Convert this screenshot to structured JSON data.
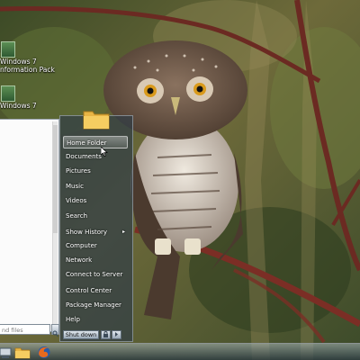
{
  "desktop": {
    "icons": [
      {
        "line1": "Windows 7",
        "line2": "nformation Pack"
      },
      {
        "line1": "Windows 7",
        "line2": ""
      }
    ]
  },
  "start_menu": {
    "items": [
      {
        "label": "Home Folder",
        "highlighted": true,
        "submenu": false
      },
      {
        "label": "Documents",
        "highlighted": false,
        "submenu": false
      },
      {
        "label": "Pictures",
        "highlighted": false,
        "submenu": false
      },
      {
        "label": "Music",
        "highlighted": false,
        "submenu": false
      },
      {
        "label": "Videos",
        "highlighted": false,
        "submenu": false
      },
      {
        "label": "Search",
        "highlighted": false,
        "submenu": false
      },
      {
        "label": "Show History",
        "highlighted": false,
        "submenu": true
      },
      {
        "label": "Computer",
        "highlighted": false,
        "submenu": false
      },
      {
        "label": "Network",
        "highlighted": false,
        "submenu": false
      },
      {
        "label": "Connect to Server",
        "highlighted": false,
        "submenu": false
      },
      {
        "label": "Control Center",
        "highlighted": false,
        "submenu": false
      },
      {
        "label": "Package Manager",
        "highlighted": false,
        "submenu": false
      },
      {
        "label": "Help",
        "highlighted": false,
        "submenu": false
      }
    ],
    "search_placeholder": "nd files",
    "shutdown_label": "Shut down",
    "submenu_arrow": "▸"
  },
  "taskbar": {
    "buttons": [
      "computer-icon",
      "folder-icon",
      "firefox-icon"
    ]
  },
  "colors": {
    "menu_pane": "#323e46",
    "highlight": "#ffffff",
    "taskbar": "#28373c"
  }
}
